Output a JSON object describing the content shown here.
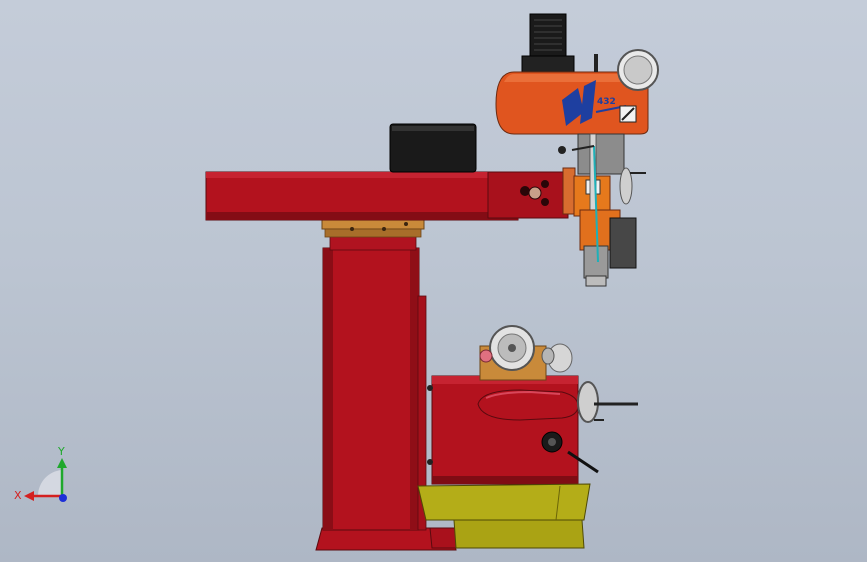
{
  "viewport": {
    "background_top": "#c4ccd9",
    "background_bottom": "#aeb7c5"
  },
  "model": {
    "head_logo_text": "432",
    "colors": {
      "frame_red": "#b3121e",
      "frame_dark": "#7f0c14",
      "head_orange": "#e0551f",
      "base_yellow": "#b4ad18",
      "brass": "#c98a3a",
      "motor_black": "#1a1a1a",
      "logo_blue": "#1e3fa0"
    }
  },
  "triad": {
    "x_label": "X",
    "y_label": "Y",
    "x_color": "#d42020",
    "y_color": "#1fa82c",
    "z_color": "#1c2fd8"
  }
}
